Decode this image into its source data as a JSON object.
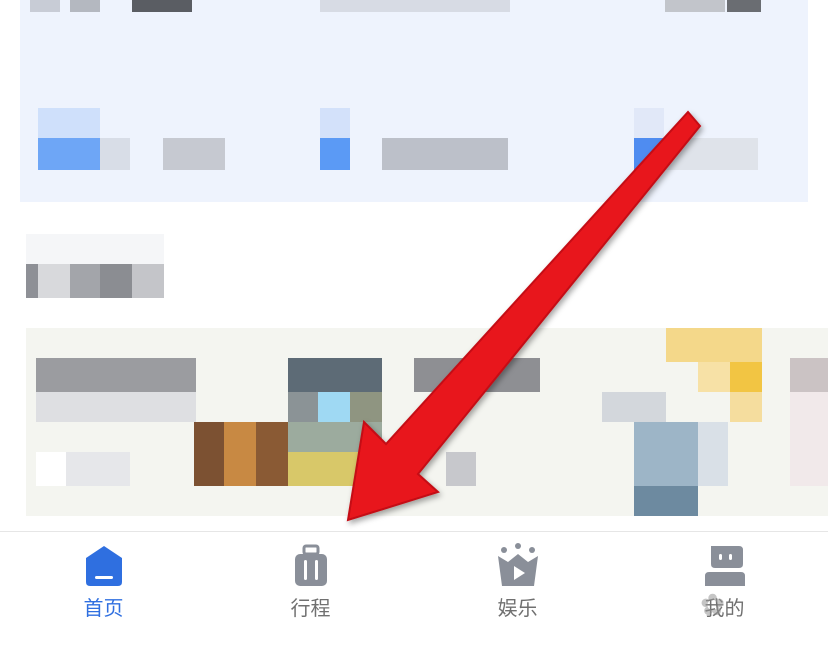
{
  "bottom_nav": {
    "items": [
      {
        "key": "home",
        "label": "首页",
        "icon": "home-icon",
        "active": true
      },
      {
        "key": "trips",
        "label": "行程",
        "icon": "suitcase-icon",
        "active": false
      },
      {
        "key": "entertainment",
        "label": "娱乐",
        "icon": "tv-crown-icon",
        "active": false
      },
      {
        "key": "mine",
        "label": "我的",
        "icon": "robot-avatar-icon",
        "active": false
      }
    ]
  },
  "colors": {
    "accent": "#2f6fe0",
    "inactive": "#8a8f99",
    "arrow": "#e8141b"
  }
}
